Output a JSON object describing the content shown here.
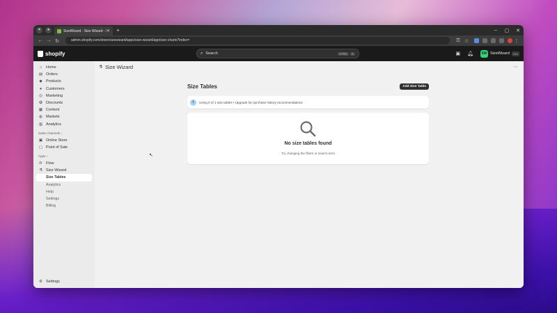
{
  "browser": {
    "tab_title": "SizeWizard - Size Wizard - Shop",
    "url": "admin.shopify.com/store/sizewizard/apps/size-wizard/app/size-charts?index="
  },
  "topbar": {
    "brand": "shopify",
    "search_placeholder": "Search",
    "search_shortcut_1": "CTRL",
    "search_shortcut_2": "K",
    "store_initials": "SW",
    "store_name": "SizeWizard",
    "store_badge": "Dev"
  },
  "sidebar": {
    "items": [
      {
        "label": "Home",
        "icon": "home-icon"
      },
      {
        "label": "Orders",
        "icon": "orders-icon"
      },
      {
        "label": "Products",
        "icon": "tag-icon"
      },
      {
        "label": "Customers",
        "icon": "person-icon"
      },
      {
        "label": "Marketing",
        "icon": "target-icon"
      },
      {
        "label": "Discounts",
        "icon": "discount-icon"
      },
      {
        "label": "Content",
        "icon": "content-icon"
      },
      {
        "label": "Markets",
        "icon": "globe-icon"
      },
      {
        "label": "Analytics",
        "icon": "chart-icon"
      }
    ],
    "sales_channels_label": "Sales channels",
    "channels": [
      {
        "label": "Online Store",
        "icon": "store-icon"
      },
      {
        "label": "Point of Sale",
        "icon": "pos-icon"
      }
    ],
    "apps_label": "Apps",
    "apps": [
      {
        "label": "Flow",
        "icon": "flow-icon"
      },
      {
        "label": "Size Wizard",
        "icon": "app-icon"
      }
    ],
    "app_subitems": [
      "Size Tables",
      "Analytics",
      "Help",
      "Settings",
      "Billing"
    ],
    "settings_label": "Settings"
  },
  "main": {
    "app_title": "Size Wizard",
    "page_title": "Size Tables",
    "add_button": "Add Size Table",
    "banner_text": "Using 0 of 1 size tables • Upgrade for purchase history recommendations",
    "empty_title": "No size tables found",
    "empty_subtitle": "Try changing the filters or search term"
  }
}
